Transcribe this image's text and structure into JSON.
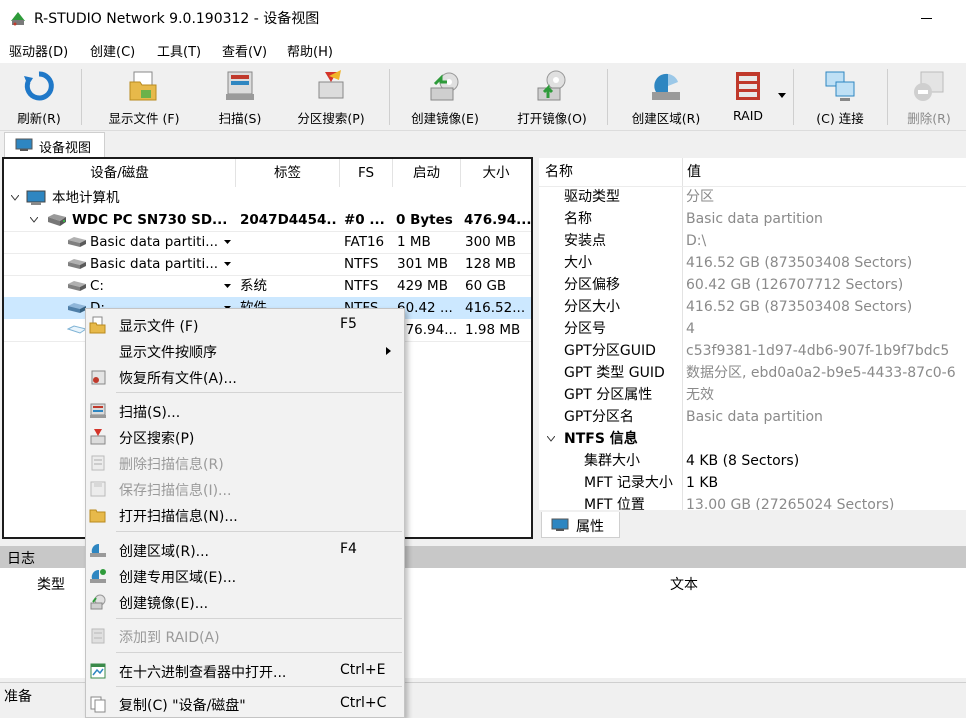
{
  "window": {
    "title": "R-STUDIO Network 9.0.190312 - 设备视图"
  },
  "menu": [
    "驱动器(D)",
    "创建(C)",
    "工具(T)",
    "查看(V)",
    "帮助(H)"
  ],
  "toolbar": {
    "refresh": "刷新(R)",
    "show_files": "显示文件 (F)",
    "scan": "扫描(S)",
    "partition_search": "分区搜索(P)",
    "create_image": "创建镜像(E)",
    "open_image": "打开镜像(O)",
    "create_region": "创建区域(R)",
    "raid": "RAID",
    "connect": "(C) 连接",
    "remove": "删除(R)"
  },
  "tabs": {
    "device_view": "设备视图",
    "properties": "属性"
  },
  "tree": {
    "headers": {
      "device": "设备/磁盘",
      "label": "标签",
      "fs": "FS",
      "start": "启动",
      "size": "大小"
    },
    "local_computer": "本地计算机",
    "rows": [
      {
        "name": "WDC PC SN730 SD...",
        "label": "2047D4454...",
        "fs": "#0 ...",
        "start": "0 Bytes",
        "size": "476.94..."
      },
      {
        "name": "Basic data partiti...",
        "label": "",
        "fs": "FAT16",
        "start": "1 MB",
        "size": "300 MB"
      },
      {
        "name": "Basic data partiti...",
        "label": "",
        "fs": "NTFS",
        "start": "301 MB",
        "size": "128 MB"
      },
      {
        "name": "C:",
        "label": "系统",
        "fs": "NTFS",
        "start": "429 MB",
        "size": "60 GB"
      },
      {
        "name": "D:",
        "label": "软件",
        "fs": "NTFS",
        "start": "60.42 ...",
        "size": "416.52..."
      },
      {
        "name": "",
        "label": "",
        "fs": "",
        "start": "476.94...",
        "size": "1.98 MB"
      }
    ]
  },
  "properties": {
    "headers": {
      "name": "名称",
      "value": "值"
    },
    "rows": [
      {
        "k": "驱动类型",
        "v": "分区"
      },
      {
        "k": "名称",
        "v": "Basic data partition"
      },
      {
        "k": "安装点",
        "v": "D:\\"
      },
      {
        "k": "大小",
        "v": "416.52 GB (873503408 Sectors)"
      },
      {
        "k": "分区偏移",
        "v": "60.42 GB (126707712 Sectors)"
      },
      {
        "k": "分区大小",
        "v": "416.52 GB (873503408 Sectors)"
      },
      {
        "k": "分区号",
        "v": "4"
      },
      {
        "k": "GPT分区GUID",
        "v": "c53f9381-1d97-4db6-907f-1b9f7bdc5"
      },
      {
        "k": "GPT 类型 GUID",
        "v": "数据分区, ebd0a0a2-b9e5-4433-87c0-6"
      },
      {
        "k": "GPT 分区属性",
        "v": "无效"
      },
      {
        "k": "GPT分区名",
        "v": "Basic data partition"
      }
    ],
    "group": "NTFS 信息",
    "group_rows": [
      {
        "k": "集群大小",
        "v": "4 KB (8 Sectors)"
      },
      {
        "k": "MFT 记录大小",
        "v": "1 KB"
      },
      {
        "k": "MFT 位置",
        "v": "13.00 GB (27265024 Sectors)"
      }
    ]
  },
  "log": {
    "title": "日志",
    "col_type": "类型",
    "col_text": "文本"
  },
  "status": "准备",
  "context_menu": {
    "show_files": {
      "label": "显示文件 (F)",
      "shortcut": "F5"
    },
    "show_files_order": "显示文件按顺序",
    "recover_all": "恢复所有文件(A)...",
    "scan": "扫描(S)...",
    "partition_search": "分区搜索(P)",
    "delete_scan": "删除扫描信息(R)",
    "save_scan": "保存扫描信息(I)...",
    "open_scan": "打开扫描信息(N)...",
    "create_region": {
      "label": "创建区域(R)...",
      "shortcut": "F4"
    },
    "create_special_region": "创建专用区域(E)...",
    "create_image": "创建镜像(E)...",
    "add_to_raid": "添加到 RAID(A)",
    "hex_viewer": {
      "label": "在十六进制查看器中打开...",
      "shortcut": "Ctrl+E"
    },
    "copy": {
      "label": "复制(C) \"设备/磁盘\"",
      "shortcut": "Ctrl+C"
    }
  }
}
